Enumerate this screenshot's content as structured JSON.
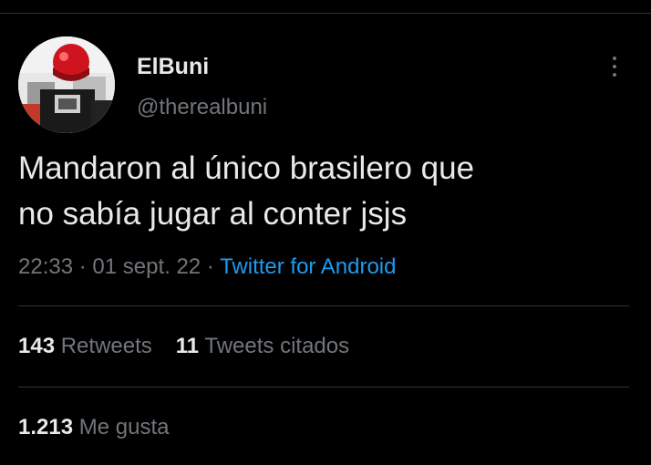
{
  "author": {
    "display_name": "ElBuni",
    "handle": "@therealbuni"
  },
  "avatar_icon": "profile-photo-avatar",
  "more_icon": "more-vertical-icon",
  "tweet": {
    "lines": [
      "Mandaron al único brasilero que",
      "no sabía jugar al conter jsjs"
    ]
  },
  "meta": {
    "time": "22:33",
    "separator": " · ",
    "date": "01 sept. 22",
    "source": "Twitter for Android"
  },
  "stats": {
    "retweets": {
      "count": "143",
      "label": "Retweets"
    },
    "quotes": {
      "count": "11",
      "label": "Tweets citados"
    },
    "likes": {
      "count": "1.213",
      "label": "Me gusta"
    }
  },
  "colors": {
    "background": "#000000",
    "text": "#e7e9ea",
    "secondary": "#71767b",
    "link": "#1d9bf0",
    "divider": "#2f3336"
  }
}
